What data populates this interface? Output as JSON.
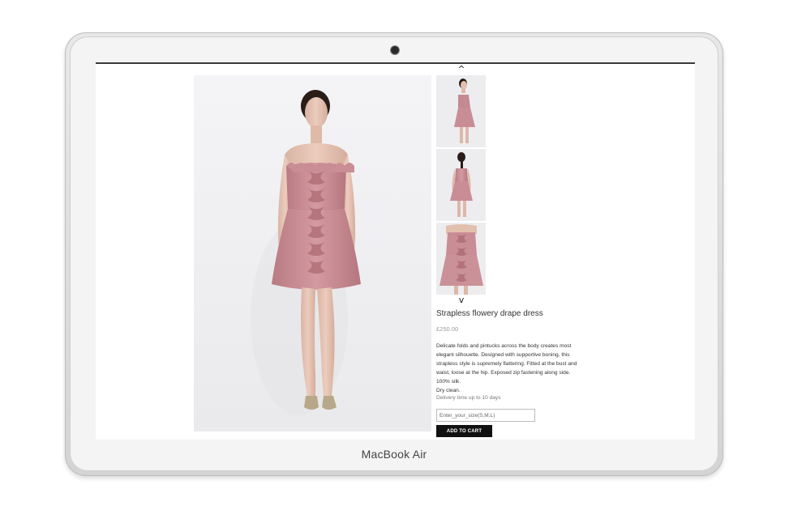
{
  "device": {
    "brand_label": "MacBook Air"
  },
  "gallery": {
    "up_arrow": "^",
    "down_arrow": "v",
    "dress_color": "#c8888f"
  },
  "product": {
    "title": "Strapless flowery drape dress",
    "price": "£250.00",
    "description": [
      "Delicate folds and pintucks across the body creates most",
      "elegant silhouette. Designed with supportive boning, this",
      "strapless style is supremely flattering. Fitted at the bust and",
      "waist, loose at the hip. Exposed zip fastening along side.",
      "100% silk.",
      "Dry clean."
    ],
    "delivery": "Delivery time up to 10 days",
    "size_placeholder": "Enter_your_size(S,M,L)",
    "add_to_cart_label": "ADD TO CART"
  }
}
